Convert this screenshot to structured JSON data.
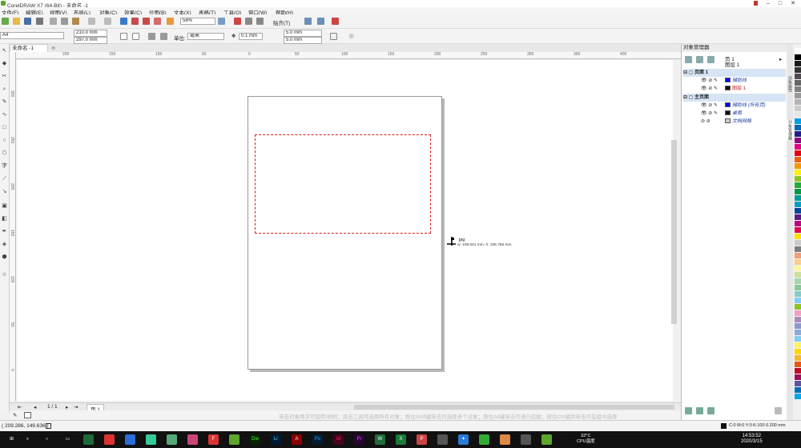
{
  "window": {
    "title": "CorelDRAW X7 (64-Bit) - 未命名 -1"
  },
  "menu": [
    "文件(F)",
    "编辑(E)",
    "视图(V)",
    "布局(L)",
    "对象(C)",
    "效果(C)",
    "位图(B)",
    "文本(X)",
    "表格(T)",
    "工具(O)",
    "窗口(W)",
    "帮助(H)"
  ],
  "toolbar_std": {
    "zoom": "58%",
    "snap_label": "贴齐(T)"
  },
  "property_bar": {
    "paper": "A4",
    "width": "210.0 mm",
    "height": "297.0 mm",
    "unit_label": "单位:",
    "unit": "毫米",
    "nudge": "0.1 mm",
    "dup_x": "5.0 mm",
    "dup_y": "5.0 mm"
  },
  "document_tab": "未命名 -1",
  "ruler_h": [
    "200",
    "150",
    "100",
    "50",
    "0",
    "50",
    "100",
    "150",
    "200",
    "250",
    "300",
    "350",
    "400"
  ],
  "ruler_v": [
    "300",
    "250",
    "200",
    "150",
    "100",
    "50",
    "0",
    "50"
  ],
  "cursor": {
    "file": "jpg",
    "size": "w: 109.041 mm, h: 106.766 mm"
  },
  "page_nav": {
    "count": "1 / 1",
    "page_tab": "页 1"
  },
  "status": {
    "coords": "( 209.286, 149.636 )",
    "hint": "单击对象两次可旋转/倾斜；双击工具可选择所有对象；按住Shift键单击可选择多个对象；按住Alt键单击可进行挖掘；按住Ctrl键并单击可在组中选择",
    "color_info": "C:0 M:0 Y:0 K:100  0.200 mm"
  },
  "object_manager": {
    "title": "对象管理器",
    "page_label": "页 1",
    "layer_label": "图层 1",
    "rows": [
      {
        "kind": "page",
        "label": "页面 1"
      },
      {
        "kind": "layer",
        "label": "辅助线",
        "swatch": "#0000ff",
        "color": "#1a3fa0"
      },
      {
        "kind": "layer",
        "label": "图层 1",
        "swatch": "#111111",
        "color": "#c81e1e"
      },
      {
        "kind": "page",
        "label": "主页面"
      },
      {
        "kind": "layer",
        "label": "辅助线 (所有页)",
        "swatch": "#0000ff",
        "color": "#1a3fa0"
      },
      {
        "kind": "layer",
        "label": "桌面",
        "swatch": "#111111",
        "color": "#1a3fa0"
      },
      {
        "kind": "layer",
        "label": "文档网格",
        "swatch": "#cccccc",
        "color": "#1a3fa0"
      }
    ]
  },
  "docker_tabs": [
    "对象属性",
    "对象管理器"
  ],
  "taskbar": {
    "temp": "32°C",
    "temp_label": "CPU温度",
    "time": "14:53:52",
    "date": "2020/3/15"
  },
  "palette": [
    "#ffffff",
    "#000000",
    "#1a1a1a",
    "#333333",
    "#4d4d4d",
    "#666666",
    "#808080",
    "#999999",
    "#b3b3b3",
    "#cccccc",
    "#e6e6e6",
    "#00a0e9",
    "#0068b7",
    "#1d2088",
    "#920783",
    "#e4007f",
    "#e60012",
    "#eb6100",
    "#f39800",
    "#fff100",
    "#8fc31f",
    "#22ac38",
    "#009944",
    "#009e96",
    "#00a0c1",
    "#00479d",
    "#601986",
    "#be0081",
    "#e5004f",
    "#ffe100",
    "#c9caca",
    "#7d7d7d",
    "#f29b76",
    "#facd89",
    "#fff799",
    "#cce198",
    "#a5d4ad",
    "#89c997",
    "#84ccc9",
    "#7ecef4",
    "#8fc31f",
    "#f19ec2",
    "#aa89bd",
    "#8c97cb",
    "#88abda",
    "#7ecef4",
    "#fff45c",
    "#ffd900",
    "#f8b62d",
    "#ea5514",
    "#c30d23",
    "#a40b5d",
    "#5f52a0",
    "#036eb8",
    "#00a7ea"
  ]
}
